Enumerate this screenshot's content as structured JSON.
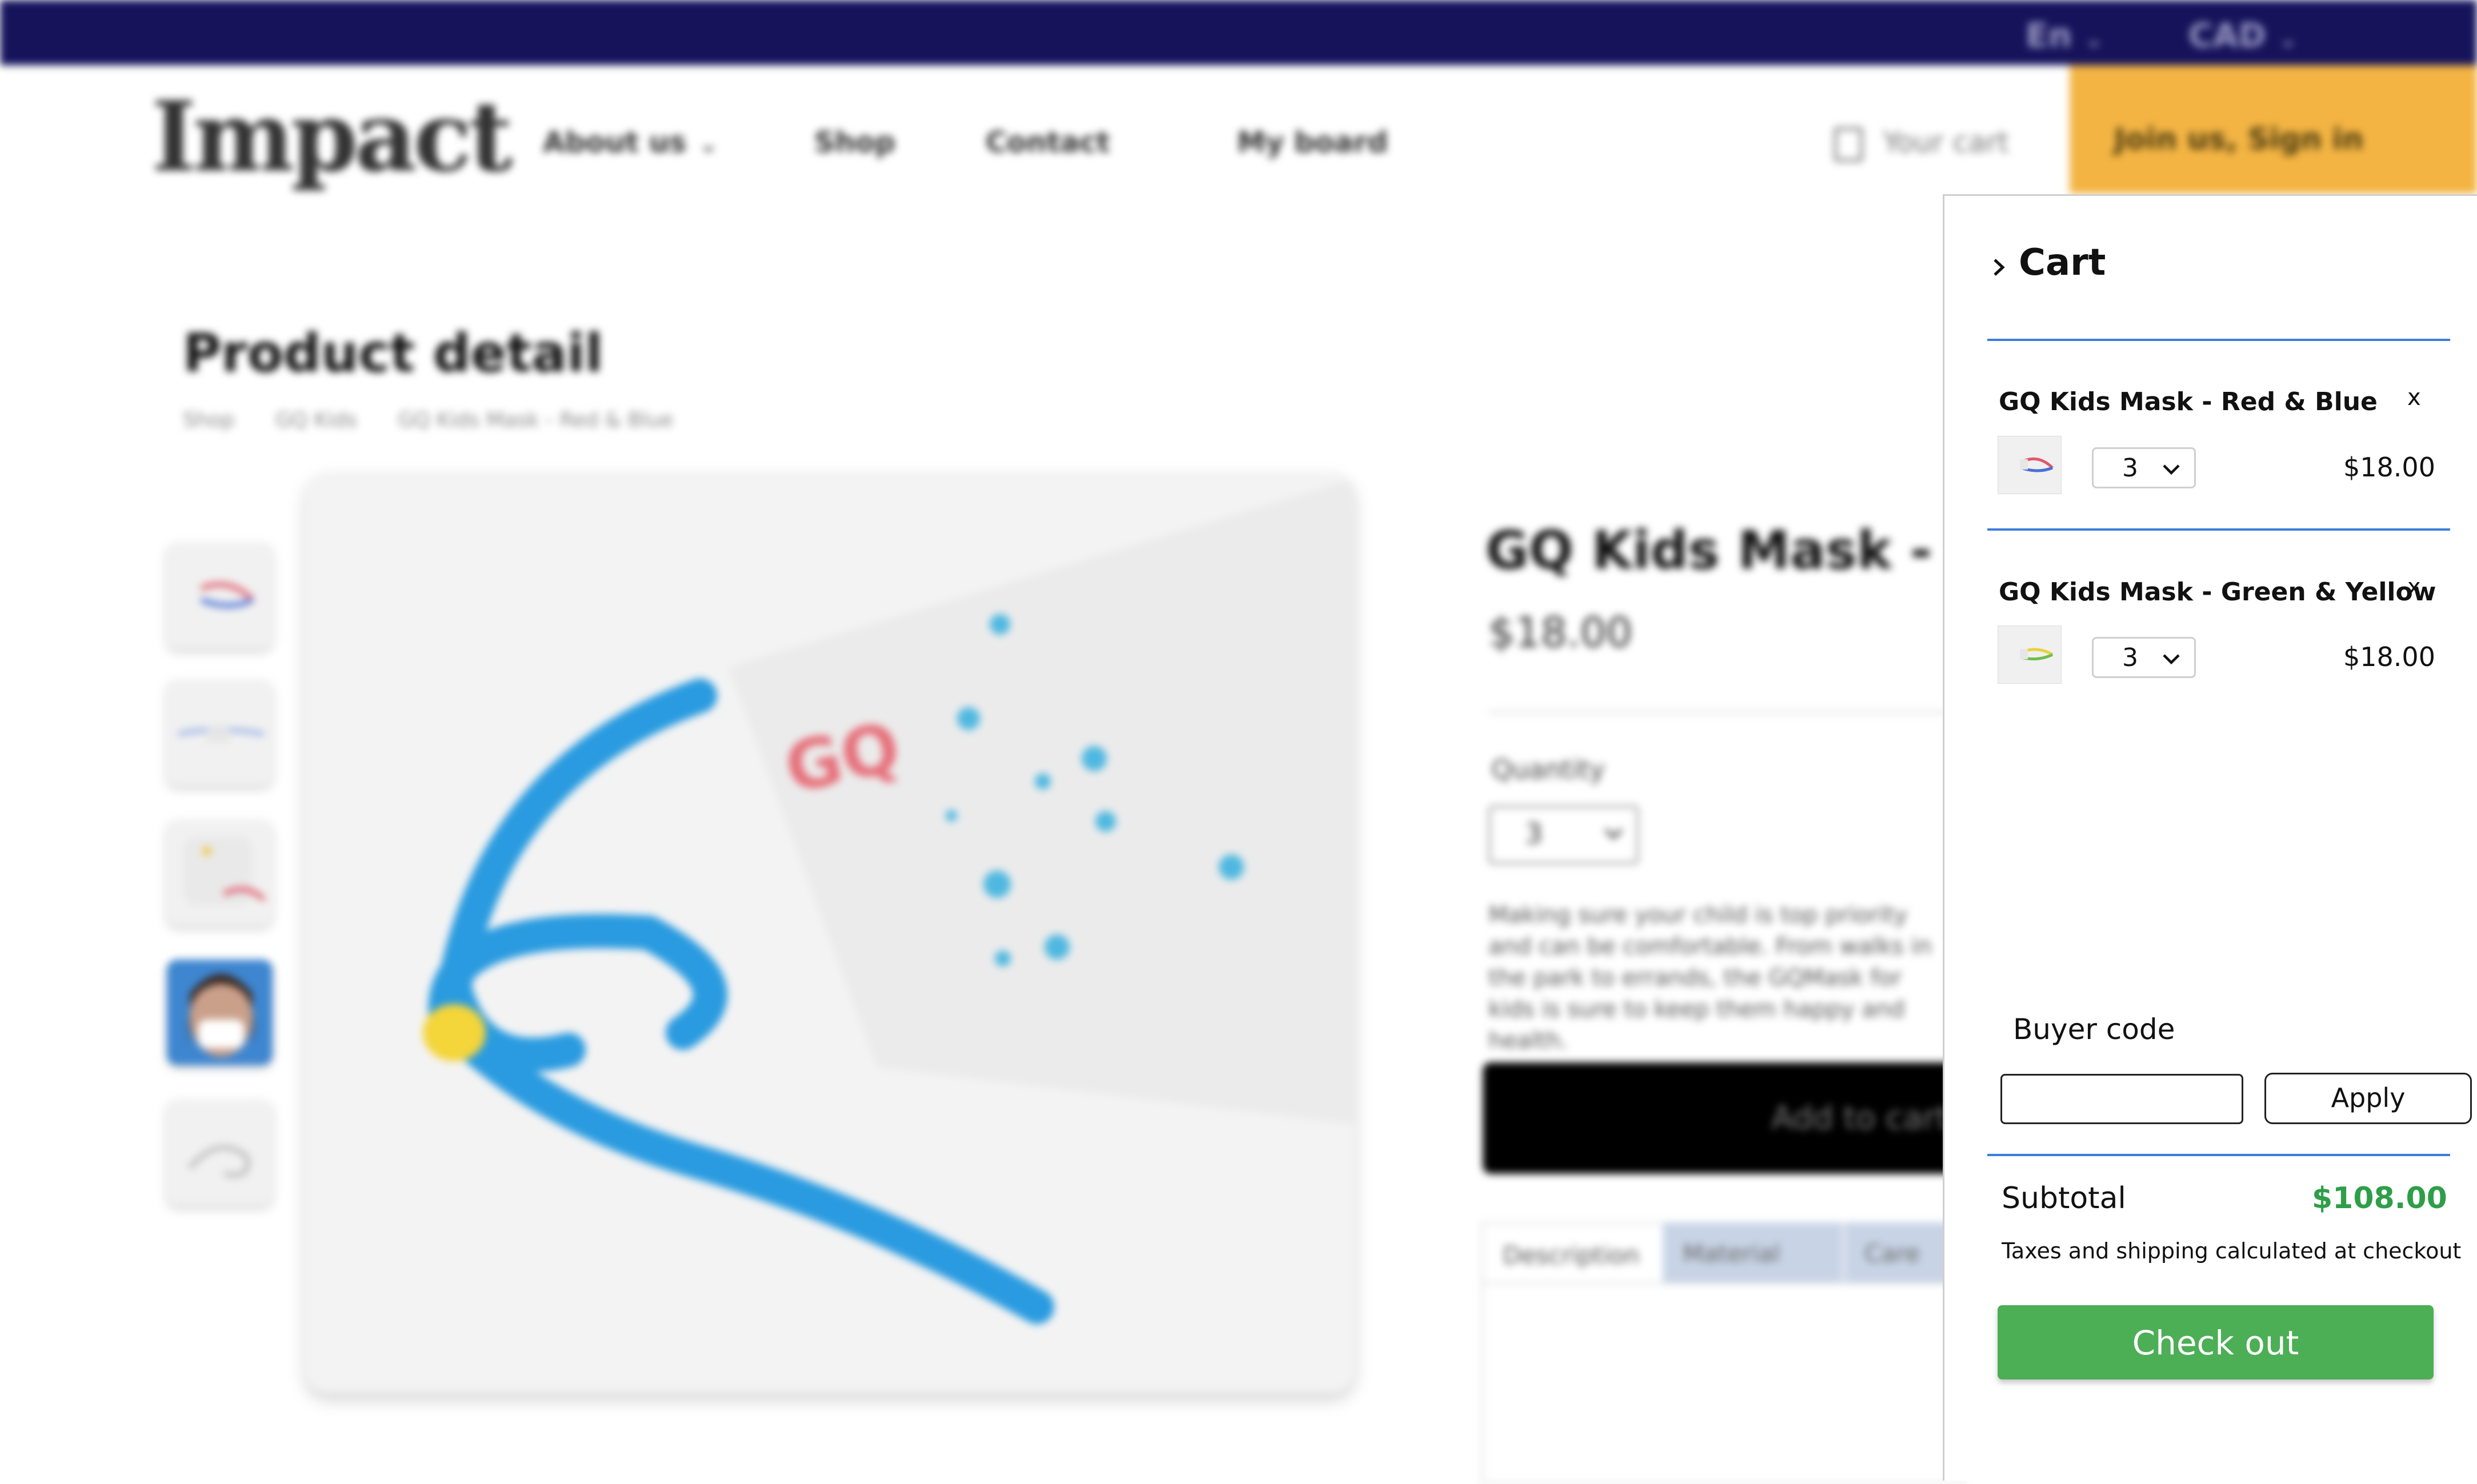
{
  "header": {
    "language": "En",
    "currency": "CAD",
    "logo_text": "Impact",
    "nav": [
      "About us",
      "Shop",
      "Contact",
      "My board"
    ],
    "cart_link": "Your cart",
    "join_label": "Join us, Sign in"
  },
  "product_page": {
    "title": "Product detail",
    "breadcrumb": [
      "Shop",
      "GQ Kids",
      "GQ Kids Mask - Red & Blue"
    ],
    "product_title": "GQ Kids Mask - Red & Blue",
    "price": "$18.00",
    "quantity_label": "Quantity",
    "quantity": "3",
    "description": "Making sure your child is top priority and can be comfortable. From walks in the park to errands, the GQMask for kids is sure to keep them happy and health.",
    "add_to_cart": "Add to cart",
    "tabs": [
      "Description",
      "Material",
      "Care"
    ]
  },
  "cart": {
    "title": "Cart",
    "items": [
      {
        "name": "GQ Kids Mask - Red & Blue",
        "quantity": "3",
        "price": "$18.00",
        "remove": "x"
      },
      {
        "name": "GQ Kids Mask - Green & Yellow",
        "quantity": "3",
        "price": "$18.00",
        "remove": "x"
      }
    ],
    "buyer_code_label": "Buyer code",
    "buyer_code_value": "",
    "apply_label": "Apply",
    "subtotal_label": "Subtotal",
    "subtotal_value": "$108.00",
    "tax_note": "Taxes and shipping calculated at checkout",
    "checkout_label": "Check out"
  },
  "colors": {
    "topbar": "#16135b",
    "join_button": "#f3b443",
    "checkout_button": "#4cae55",
    "subtotal_text": "#2f9e48",
    "divider": "#3c7ddb"
  }
}
